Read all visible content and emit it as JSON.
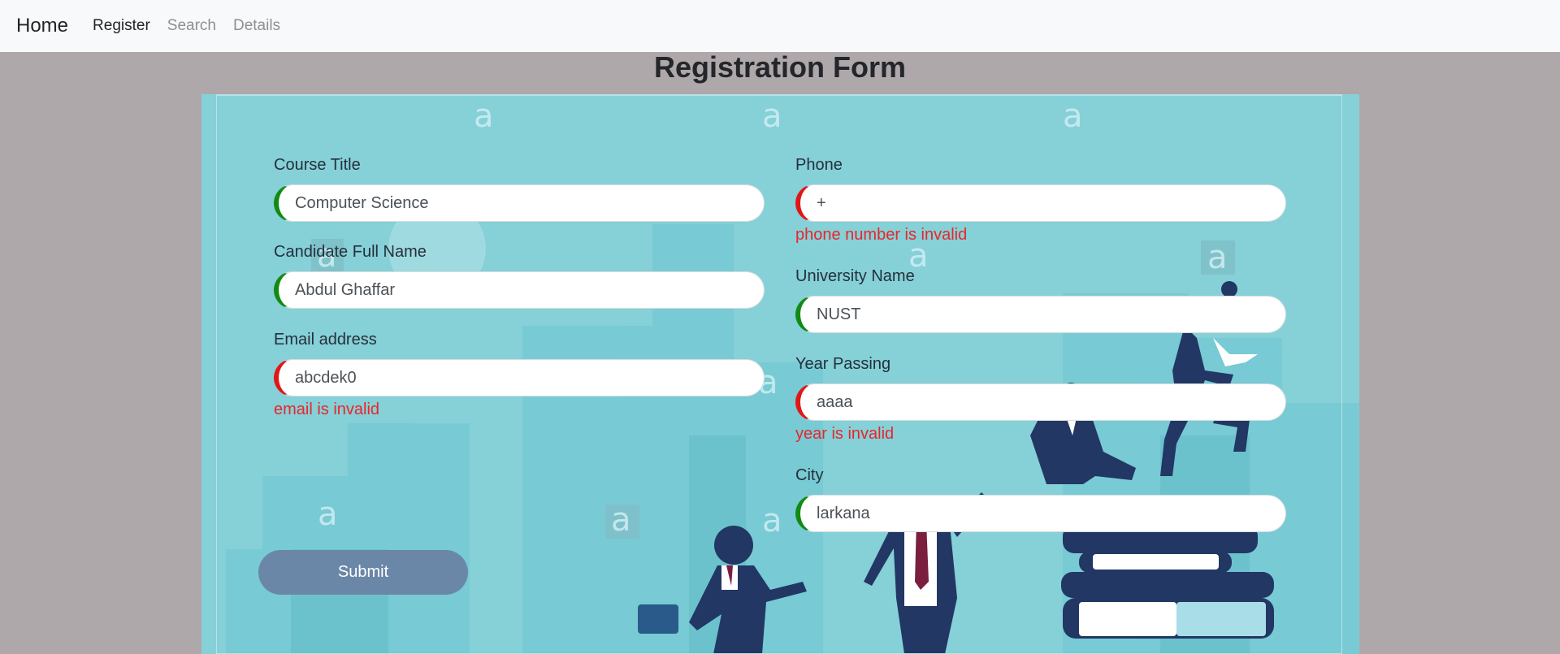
{
  "nav": {
    "brand": "Home",
    "links": [
      "Register",
      "Search",
      "Details"
    ]
  },
  "page_title": "Registration Form",
  "form": {
    "course_title": {
      "label": "Course Title",
      "value": "Computer Science",
      "state": "valid"
    },
    "full_name": {
      "label": "Candidate Full Name",
      "value": "Abdul Ghaffar",
      "state": "valid"
    },
    "email": {
      "label": "Email address",
      "value": "abcdek0",
      "state": "invalid",
      "error": "email is invalid"
    },
    "phone": {
      "label": "Phone",
      "value": "+",
      "state": "invalid",
      "error": "phone number is invalid"
    },
    "university": {
      "label": "University Name",
      "value": "NUST",
      "state": "valid"
    },
    "year": {
      "label": "Year Passing",
      "value": "aaaa",
      "state": "invalid",
      "error": "year is invalid"
    },
    "city": {
      "label": "City",
      "value": "larkana",
      "state": "valid"
    },
    "submit_label": "Submit"
  },
  "colors": {
    "valid": "#138a13",
    "invalid": "#e01717",
    "error_text": "#e8262a",
    "panel": "#86d0d8",
    "submit": "#6b87a8"
  },
  "background": {
    "watermark_glyph": "a"
  }
}
